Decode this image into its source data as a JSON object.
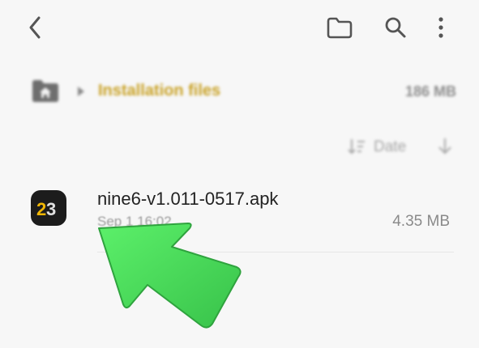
{
  "header": {
    "back_icon": "chevron-left-icon",
    "folder_icon": "folder-icon",
    "search_icon": "search-icon",
    "more_icon": "more-vertical-icon"
  },
  "breadcrumb": {
    "home_icon": "home-folder-icon",
    "separator_icon": "caret-right-icon",
    "current": "Installation files",
    "total_size": "186 MB",
    "accent_color": "#c9a227"
  },
  "sort": {
    "label": "Date",
    "sort_icon": "sort-icon",
    "direction_icon": "arrow-down-icon"
  },
  "files": [
    {
      "name": "nine6-v1.011-0517.apk",
      "date": "Sep 1 16:02",
      "size": "4.35 MB",
      "icon": "app-icon-23"
    }
  ],
  "overlay": {
    "pointer_arrow_color": "#4fe05f"
  }
}
